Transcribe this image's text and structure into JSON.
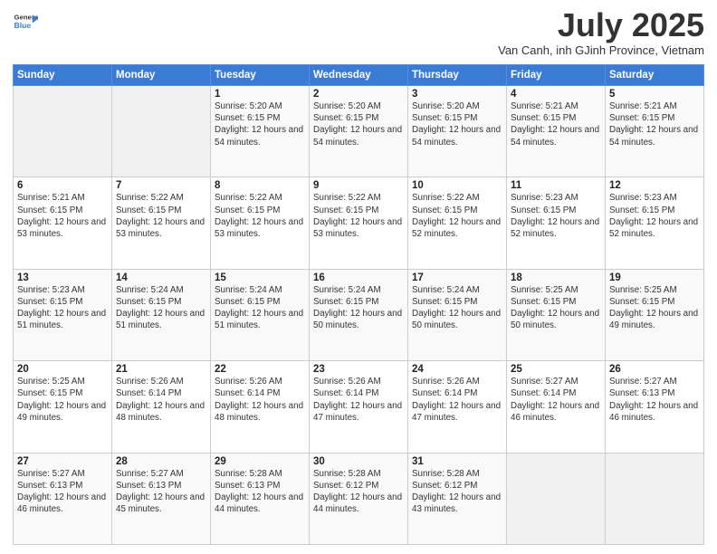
{
  "header": {
    "logo": {
      "general": "General",
      "blue": "Blue"
    },
    "title": "July 2025",
    "location": "Van Canh, inh GJinh Province, Vietnam"
  },
  "days_of_week": [
    "Sunday",
    "Monday",
    "Tuesday",
    "Wednesday",
    "Thursday",
    "Friday",
    "Saturday"
  ],
  "weeks": [
    [
      {
        "day": "",
        "info": ""
      },
      {
        "day": "",
        "info": ""
      },
      {
        "day": "1",
        "info": "Sunrise: 5:20 AM\nSunset: 6:15 PM\nDaylight: 12 hours and 54 minutes."
      },
      {
        "day": "2",
        "info": "Sunrise: 5:20 AM\nSunset: 6:15 PM\nDaylight: 12 hours and 54 minutes."
      },
      {
        "day": "3",
        "info": "Sunrise: 5:20 AM\nSunset: 6:15 PM\nDaylight: 12 hours and 54 minutes."
      },
      {
        "day": "4",
        "info": "Sunrise: 5:21 AM\nSunset: 6:15 PM\nDaylight: 12 hours and 54 minutes."
      },
      {
        "day": "5",
        "info": "Sunrise: 5:21 AM\nSunset: 6:15 PM\nDaylight: 12 hours and 54 minutes."
      }
    ],
    [
      {
        "day": "6",
        "info": "Sunrise: 5:21 AM\nSunset: 6:15 PM\nDaylight: 12 hours and 53 minutes."
      },
      {
        "day": "7",
        "info": "Sunrise: 5:22 AM\nSunset: 6:15 PM\nDaylight: 12 hours and 53 minutes."
      },
      {
        "day": "8",
        "info": "Sunrise: 5:22 AM\nSunset: 6:15 PM\nDaylight: 12 hours and 53 minutes."
      },
      {
        "day": "9",
        "info": "Sunrise: 5:22 AM\nSunset: 6:15 PM\nDaylight: 12 hours and 53 minutes."
      },
      {
        "day": "10",
        "info": "Sunrise: 5:22 AM\nSunset: 6:15 PM\nDaylight: 12 hours and 52 minutes."
      },
      {
        "day": "11",
        "info": "Sunrise: 5:23 AM\nSunset: 6:15 PM\nDaylight: 12 hours and 52 minutes."
      },
      {
        "day": "12",
        "info": "Sunrise: 5:23 AM\nSunset: 6:15 PM\nDaylight: 12 hours and 52 minutes."
      }
    ],
    [
      {
        "day": "13",
        "info": "Sunrise: 5:23 AM\nSunset: 6:15 PM\nDaylight: 12 hours and 51 minutes."
      },
      {
        "day": "14",
        "info": "Sunrise: 5:24 AM\nSunset: 6:15 PM\nDaylight: 12 hours and 51 minutes."
      },
      {
        "day": "15",
        "info": "Sunrise: 5:24 AM\nSunset: 6:15 PM\nDaylight: 12 hours and 51 minutes."
      },
      {
        "day": "16",
        "info": "Sunrise: 5:24 AM\nSunset: 6:15 PM\nDaylight: 12 hours and 50 minutes."
      },
      {
        "day": "17",
        "info": "Sunrise: 5:24 AM\nSunset: 6:15 PM\nDaylight: 12 hours and 50 minutes."
      },
      {
        "day": "18",
        "info": "Sunrise: 5:25 AM\nSunset: 6:15 PM\nDaylight: 12 hours and 50 minutes."
      },
      {
        "day": "19",
        "info": "Sunrise: 5:25 AM\nSunset: 6:15 PM\nDaylight: 12 hours and 49 minutes."
      }
    ],
    [
      {
        "day": "20",
        "info": "Sunrise: 5:25 AM\nSunset: 6:15 PM\nDaylight: 12 hours and 49 minutes."
      },
      {
        "day": "21",
        "info": "Sunrise: 5:26 AM\nSunset: 6:14 PM\nDaylight: 12 hours and 48 minutes."
      },
      {
        "day": "22",
        "info": "Sunrise: 5:26 AM\nSunset: 6:14 PM\nDaylight: 12 hours and 48 minutes."
      },
      {
        "day": "23",
        "info": "Sunrise: 5:26 AM\nSunset: 6:14 PM\nDaylight: 12 hours and 47 minutes."
      },
      {
        "day": "24",
        "info": "Sunrise: 5:26 AM\nSunset: 6:14 PM\nDaylight: 12 hours and 47 minutes."
      },
      {
        "day": "25",
        "info": "Sunrise: 5:27 AM\nSunset: 6:14 PM\nDaylight: 12 hours and 46 minutes."
      },
      {
        "day": "26",
        "info": "Sunrise: 5:27 AM\nSunset: 6:13 PM\nDaylight: 12 hours and 46 minutes."
      }
    ],
    [
      {
        "day": "27",
        "info": "Sunrise: 5:27 AM\nSunset: 6:13 PM\nDaylight: 12 hours and 46 minutes."
      },
      {
        "day": "28",
        "info": "Sunrise: 5:27 AM\nSunset: 6:13 PM\nDaylight: 12 hours and 45 minutes."
      },
      {
        "day": "29",
        "info": "Sunrise: 5:28 AM\nSunset: 6:13 PM\nDaylight: 12 hours and 44 minutes."
      },
      {
        "day": "30",
        "info": "Sunrise: 5:28 AM\nSunset: 6:12 PM\nDaylight: 12 hours and 44 minutes."
      },
      {
        "day": "31",
        "info": "Sunrise: 5:28 AM\nSunset: 6:12 PM\nDaylight: 12 hours and 43 minutes."
      },
      {
        "day": "",
        "info": ""
      },
      {
        "day": "",
        "info": ""
      }
    ]
  ]
}
